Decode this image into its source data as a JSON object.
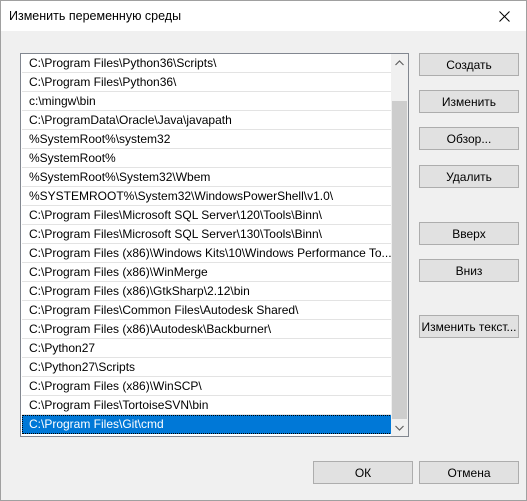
{
  "window": {
    "title": "Изменить переменную среды"
  },
  "list": {
    "items": [
      "C:\\Program Files\\Python36\\Scripts\\",
      "C:\\Program Files\\Python36\\",
      "c:\\mingw\\bin",
      "C:\\ProgramData\\Oracle\\Java\\javapath",
      "%SystemRoot%\\system32",
      "%SystemRoot%",
      "%SystemRoot%\\System32\\Wbem",
      "%SYSTEMROOT%\\System32\\WindowsPowerShell\\v1.0\\",
      "C:\\Program Files\\Microsoft SQL Server\\120\\Tools\\Binn\\",
      "C:\\Program Files\\Microsoft SQL Server\\130\\Tools\\Binn\\",
      "C:\\Program Files (x86)\\Windows Kits\\10\\Windows Performance To...",
      "C:\\Program Files (x86)\\WinMerge",
      "C:\\Program Files (x86)\\GtkSharp\\2.12\\bin",
      "C:\\Program Files\\Common Files\\Autodesk Shared\\",
      "C:\\Program Files (x86)\\Autodesk\\Backburner\\",
      "C:\\Python27",
      "C:\\Python27\\Scripts",
      "C:\\Program Files (x86)\\WinSCP\\",
      "C:\\Program Files\\TortoiseSVN\\bin",
      "C:\\Program Files\\Git\\cmd"
    ],
    "selected_index": 19
  },
  "buttons": {
    "create": "Создать",
    "edit": "Изменить",
    "browse": "Обзор...",
    "delete": "Удалить",
    "up": "Вверх",
    "down": "Вниз",
    "edit_text": "Изменить текст...",
    "ok": "ОК",
    "cancel": "Отмена"
  },
  "colors": {
    "selection": "#0078d7",
    "window_bg": "#f0f0f0"
  }
}
